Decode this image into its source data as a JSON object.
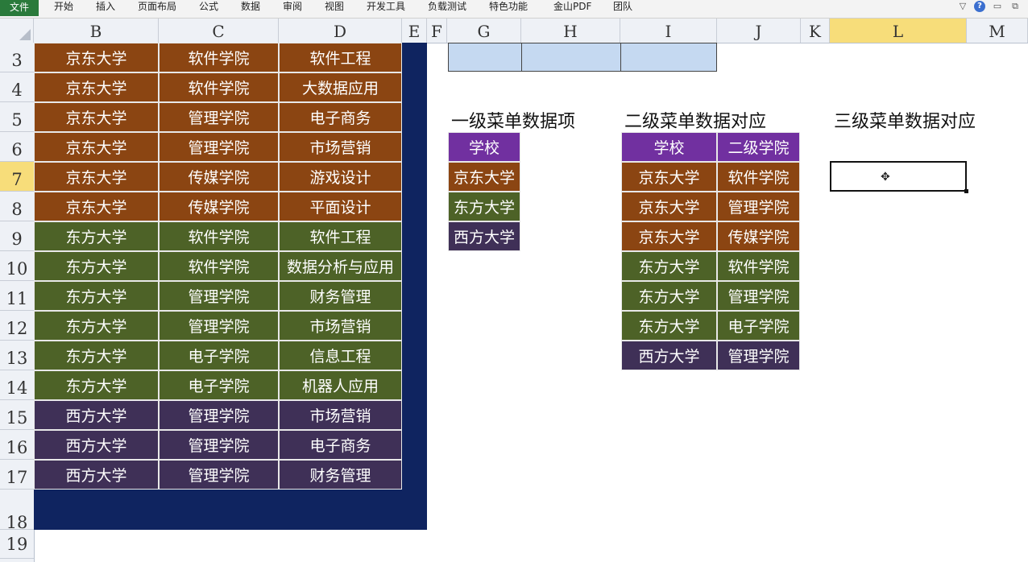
{
  "ribbon": {
    "tabs": [
      "文件",
      "开始",
      "插入",
      "页面布局",
      "公式",
      "数据",
      "审阅",
      "视图",
      "开发工具",
      "负载测试",
      "特色功能",
      "金山PDF",
      "团队"
    ]
  },
  "columns": [
    "B",
    "C",
    "D",
    "E",
    "F",
    "G",
    "H",
    "I",
    "J",
    "K",
    "L",
    "M"
  ],
  "rows": [
    "3",
    "4",
    "5",
    "6",
    "7",
    "8",
    "9",
    "10",
    "11",
    "12",
    "13",
    "14",
    "15",
    "16",
    "17",
    "18",
    "19"
  ],
  "data_table": {
    "rows": [
      [
        "京东大学",
        "软件学院",
        "软件工程"
      ],
      [
        "京东大学",
        "软件学院",
        "大数据应用"
      ],
      [
        "京东大学",
        "管理学院",
        "电子商务"
      ],
      [
        "京东大学",
        "管理学院",
        "市场营销"
      ],
      [
        "京东大学",
        "传媒学院",
        "游戏设计"
      ],
      [
        "京东大学",
        "传媒学院",
        "平面设计"
      ],
      [
        "东方大学",
        "软件学院",
        "软件工程"
      ],
      [
        "东方大学",
        "软件学院",
        "数据分析与应用"
      ],
      [
        "东方大学",
        "管理学院",
        "财务管理"
      ],
      [
        "东方大学",
        "管理学院",
        "市场营销"
      ],
      [
        "东方大学",
        "电子学院",
        "信息工程"
      ],
      [
        "东方大学",
        "电子学院",
        "机器人应用"
      ],
      [
        "西方大学",
        "管理学院",
        "市场营销"
      ],
      [
        "西方大学",
        "管理学院",
        "电子商务"
      ],
      [
        "西方大学",
        "管理学院",
        "财务管理"
      ]
    ]
  },
  "level1": {
    "title": "一级菜单数据项",
    "header": "学校",
    "items": [
      "京东大学",
      "东方大学",
      "西方大学"
    ]
  },
  "level2": {
    "title": "二级菜单数据对应",
    "headers": [
      "学校",
      "二级学院"
    ],
    "rows": [
      [
        "京东大学",
        "软件学院"
      ],
      [
        "京东大学",
        "管理学院"
      ],
      [
        "京东大学",
        "传媒学院"
      ],
      [
        "东方大学",
        "软件学院"
      ],
      [
        "东方大学",
        "管理学院"
      ],
      [
        "东方大学",
        "电子学院"
      ],
      [
        "西方大学",
        "管理学院"
      ]
    ]
  },
  "level3": {
    "title": "三级菜单数据对应",
    "selected_value": ""
  },
  "colors": {
    "jingdong": "#8b4512",
    "dongfang": "#4d6227",
    "xifang": "#3f3057",
    "header_purple": "#7130a0",
    "navy": "#0f2460",
    "light_blue": "#c5d9f1",
    "selected_header": "#f7dd7a"
  },
  "icons": [
    "chevron-down-icon",
    "help-icon",
    "minimize-icon",
    "restore-icon"
  ]
}
